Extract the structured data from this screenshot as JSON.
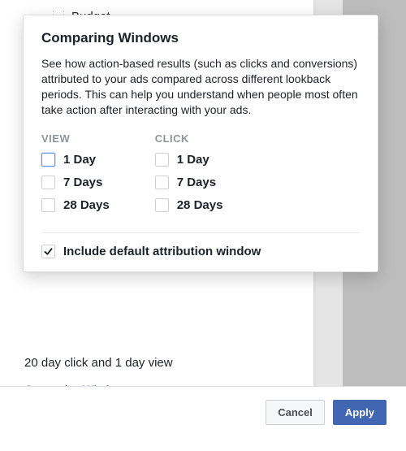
{
  "bg": {
    "row_label": "Budget",
    "cutoff_text": "20 day click and 1 day view",
    "link_text": "Comparing Windows"
  },
  "footer": {
    "cancel": "Cancel",
    "apply": "Apply"
  },
  "popover": {
    "title": "Comparing Windows",
    "desc": "See how action-based results (such as clicks and conversions) attributed to your ads compared across different lookback periods. This can help you understand when people most often take action after interacting with your ads.",
    "view_head": "VIEW",
    "click_head": "CLICK",
    "options": {
      "d1": "1 Day",
      "d7": "7 Days",
      "d28": "28 Days"
    },
    "include_label": "Include default attribution window"
  }
}
